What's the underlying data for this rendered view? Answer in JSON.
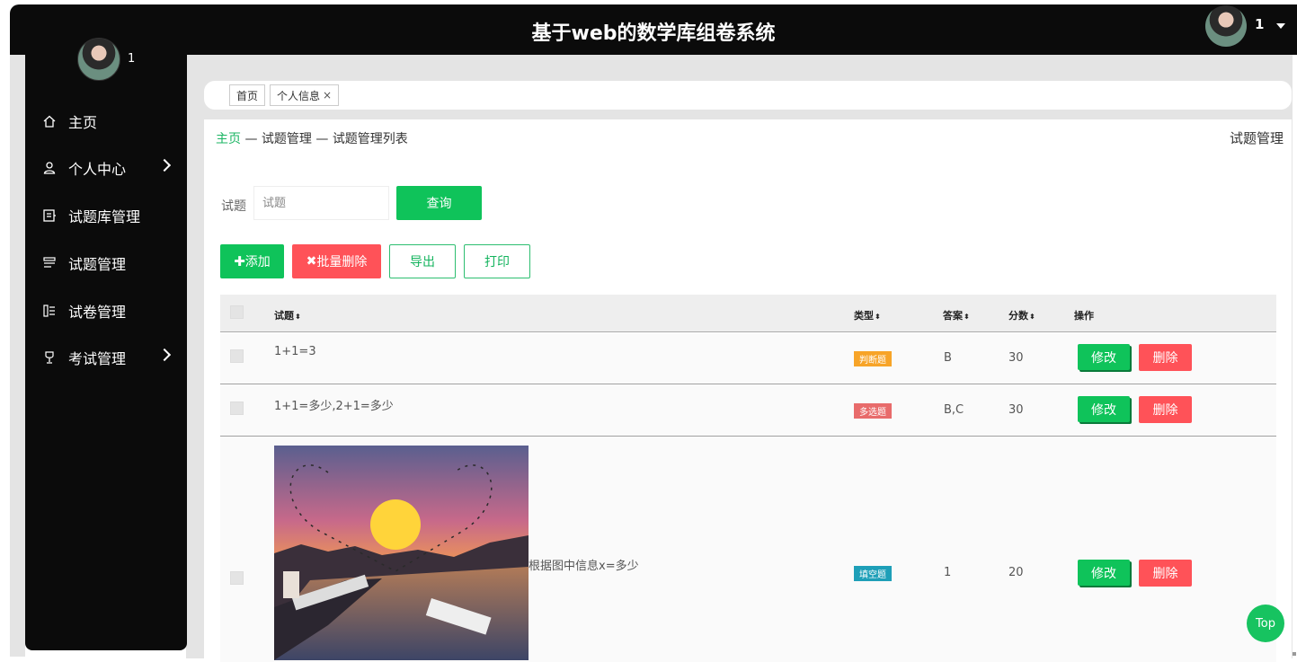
{
  "header": {
    "title": "基于web的数学库组卷系统",
    "username": "1"
  },
  "sidebar": {
    "username": "1",
    "items": [
      {
        "label": "主页",
        "icon": "home-icon"
      },
      {
        "label": "个人中心",
        "icon": "user-icon",
        "has_submenu": true
      },
      {
        "label": "试题库管理",
        "icon": "question-bank-icon"
      },
      {
        "label": "试题管理",
        "icon": "list-icon"
      },
      {
        "label": "试卷管理",
        "icon": "paper-icon"
      },
      {
        "label": "考试管理",
        "icon": "trophy-icon",
        "has_submenu": true
      }
    ]
  },
  "tabs": [
    {
      "label": "首页"
    },
    {
      "label": "个人信息",
      "close": "×"
    }
  ],
  "breadcrumb": {
    "home": "主页",
    "sep1": " — ",
    "level1": "试题管理",
    "sep2": " — ",
    "level2": "试题管理列表"
  },
  "page_title": "试题管理",
  "search": {
    "label": "试题",
    "placeholder": "试题",
    "button": "查询"
  },
  "toolbar": {
    "add": "添加",
    "batch_delete": "批量删除",
    "export": "导出",
    "print": "打印"
  },
  "table": {
    "headers": {
      "question": "试题",
      "type": "类型",
      "answer": "答案",
      "score": "分数",
      "actions": "操作"
    },
    "sort_glyph": "⬍",
    "rows": [
      {
        "question": "1+1=3",
        "type": "判断题",
        "type_color": "#f7a428",
        "answer": "B",
        "score": "30",
        "edit": "修改",
        "delete": "删除"
      },
      {
        "question": "1+1=多少,2+1=多少",
        "type": "多选题",
        "type_color": "#e86b6b",
        "answer": "B,C",
        "score": "30",
        "edit": "修改",
        "delete": "删除"
      },
      {
        "question": "根据图中信息x=多少",
        "type": "填空题",
        "type_color": "#1e9fb8",
        "answer": "1",
        "score": "20",
        "edit": "修改",
        "delete": "删除",
        "has_image": true
      }
    ]
  },
  "back_to_top": "Top",
  "colors": {
    "accent": "#0fc35a",
    "danger": "#ff5258",
    "sidebar_bg": "#0b0b0b"
  }
}
